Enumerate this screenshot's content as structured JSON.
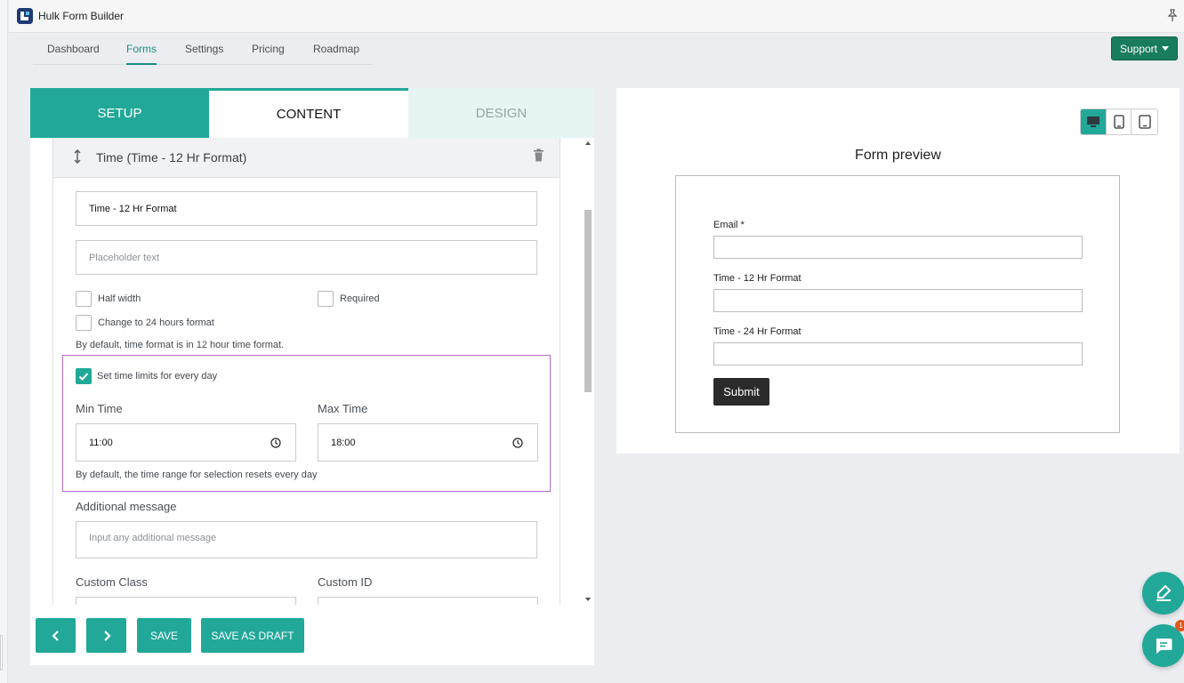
{
  "app": {
    "title": "Hulk Form Builder",
    "icon": "hulk-logo-icon"
  },
  "nav": {
    "items": [
      {
        "label": "Dashboard"
      },
      {
        "label": "Forms",
        "active": true
      },
      {
        "label": "Settings"
      },
      {
        "label": "Pricing"
      },
      {
        "label": "Roadmap"
      }
    ],
    "support_label": "Support"
  },
  "editor": {
    "tabs": {
      "setup": "SETUP",
      "content": "CONTENT",
      "design": "DESIGN"
    },
    "field_header": "Time (Time - 12 Hr Format)",
    "label_value": "Time - 12 Hr Format",
    "placeholder_field_placeholder": "Placeholder text",
    "options": {
      "half_width": {
        "label": "Half width",
        "checked": false
      },
      "required": {
        "label": "Required",
        "checked": false
      },
      "format_24h": {
        "label": "Change to 24 hours format",
        "checked": false
      }
    },
    "format_hint": "By default, time format is in 12 hour time format.",
    "time_limits": {
      "checkbox_label": "Set time limits for every day",
      "checked": true,
      "min_label": "Min Time",
      "min_value": "11:00",
      "max_label": "Max Time",
      "max_value": "18:00",
      "hint": "By default, the time range for selection resets every day"
    },
    "additional_message": {
      "label": "Additional message",
      "placeholder": "Input any additional message"
    },
    "custom_class_label": "Custom Class",
    "custom_id_label": "Custom ID",
    "buttons": {
      "save": "SAVE",
      "save_draft": "SAVE AS DRAFT"
    }
  },
  "preview": {
    "title": "Form preview",
    "devices": [
      "desktop-icon",
      "tablet-icon",
      "mobile-icon"
    ],
    "active_device": "desktop",
    "fields": [
      {
        "label": "Email *"
      },
      {
        "label": "Time - 12 Hr Format"
      },
      {
        "label": "Time - 24 Hr Format"
      }
    ],
    "submit_label": "Submit"
  },
  "chat": {
    "badge": "1"
  },
  "colors": {
    "accent": "#21a898",
    "support": "#1a7c5e",
    "highlight_border": "#b36ac8"
  }
}
